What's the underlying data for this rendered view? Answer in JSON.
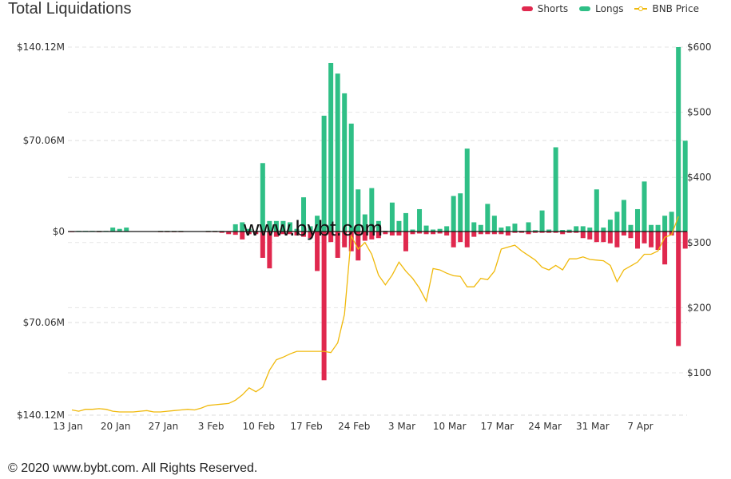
{
  "header": {
    "title": "Total Liquidations"
  },
  "legend": [
    {
      "label": "Shorts",
      "color": "#e0284e",
      "icon": "bar-swatch"
    },
    {
      "label": "Longs",
      "color": "#2fbf86",
      "icon": "bar-swatch"
    },
    {
      "label": "BNB Price",
      "color": "#f0b90b",
      "icon": "line-marker"
    }
  ],
  "watermark": "www.bybt.com",
  "footer": "© 2020 www.bybt.com. All Rights Reserved.",
  "chart_data": {
    "type": "bar",
    "title": "Total Liquidations",
    "left_axis": {
      "ticks": [
        "$140.12M",
        "$70.06M",
        "$0",
        "$70.06M",
        "$140.12M"
      ],
      "range": [
        -140.12,
        140.12
      ],
      "unit": "M USD"
    },
    "right_axis": {
      "ticks": [
        "$100",
        "$200",
        "$300",
        "$400",
        "$500",
        "$600"
      ],
      "range": [
        40,
        600
      ]
    },
    "x_tick_labels": [
      "13 Jan",
      "20 Jan",
      "27 Jan",
      "3 Feb",
      "10 Feb",
      "17 Feb",
      "24 Feb",
      "3 Mar",
      "10 Mar",
      "17 Mar",
      "24 Mar",
      "31 Mar",
      "7 Apr"
    ],
    "start_date": "13 Jan",
    "days": 90,
    "series": [
      {
        "name": "Longs",
        "color": "#2fbf86",
        "values": [
          0.3,
          0.5,
          0.5,
          0.5,
          0.5,
          0.5,
          3,
          2,
          3,
          0.3,
          0.3,
          0.3,
          0.3,
          0.5,
          0.5,
          0.5,
          0.5,
          0.3,
          0.3,
          0.3,
          0.5,
          0.5,
          0.5,
          0.3,
          5.5,
          7,
          2,
          0.5,
          52,
          8,
          8,
          8,
          7,
          2,
          26,
          4,
          12,
          88,
          128,
          120,
          105,
          82,
          32,
          13,
          33,
          8,
          0.6,
          22,
          8,
          14,
          1.5,
          17,
          4.5,
          1.5,
          2,
          4,
          27,
          29,
          63,
          7,
          5,
          21,
          12,
          3,
          4,
          6,
          0.6,
          7,
          1,
          16,
          1.5,
          64,
          1.2,
          1.4,
          4,
          4,
          3,
          32,
          3,
          9,
          15,
          24,
          5,
          17,
          38,
          5,
          5,
          12,
          15,
          140.12,
          69
        ]
      },
      {
        "name": "Shorts",
        "color": "#e0284e",
        "values": [
          0.5,
          0.3,
          0.3,
          0.3,
          0.5,
          0.3,
          0.3,
          0.3,
          0.3,
          0.3,
          0.3,
          0.3,
          0.3,
          0.5,
          0.5,
          0.5,
          0.5,
          0.3,
          0.3,
          0.3,
          0.5,
          0.5,
          1,
          2,
          2.5,
          6,
          2,
          2,
          20,
          28,
          4,
          2,
          2,
          3,
          4,
          5,
          30,
          113,
          8,
          20,
          12,
          15,
          22,
          7,
          6,
          5,
          2,
          3,
          3,
          15,
          2,
          1.5,
          2,
          2,
          1.5,
          3,
          12,
          8,
          12,
          4,
          2,
          2,
          2,
          2,
          3,
          1,
          1,
          2,
          1,
          1,
          1,
          1,
          2,
          1,
          1,
          5,
          6,
          8,
          8,
          9,
          12,
          3,
          5,
          13,
          9,
          12,
          14,
          25,
          3,
          87,
          13
        ]
      },
      {
        "name": "BNB Price",
        "color": "#f0b90b",
        "type": "line",
        "values": [
          43,
          41,
          44,
          44,
          45,
          44,
          41,
          40,
          40,
          40,
          41,
          42,
          40,
          40,
          41,
          42,
          43,
          44,
          43,
          46,
          50,
          51,
          52,
          53,
          58,
          66,
          77,
          71,
          78,
          104,
          120,
          124,
          129,
          133,
          133,
          133,
          133,
          133,
          131,
          146,
          190,
          310,
          290,
          300,
          282,
          250,
          235,
          250,
          270,
          256,
          245,
          230,
          210,
          260,
          258,
          253,
          249,
          248,
          232,
          232,
          245,
          243,
          256,
          290,
          293,
          296,
          287,
          280,
          273,
          262,
          258,
          265,
          258,
          275,
          275,
          278,
          274,
          273,
          272,
          265,
          240,
          258,
          264,
          270,
          282,
          282,
          287,
          308,
          312,
          340
        ]
      }
    ]
  }
}
